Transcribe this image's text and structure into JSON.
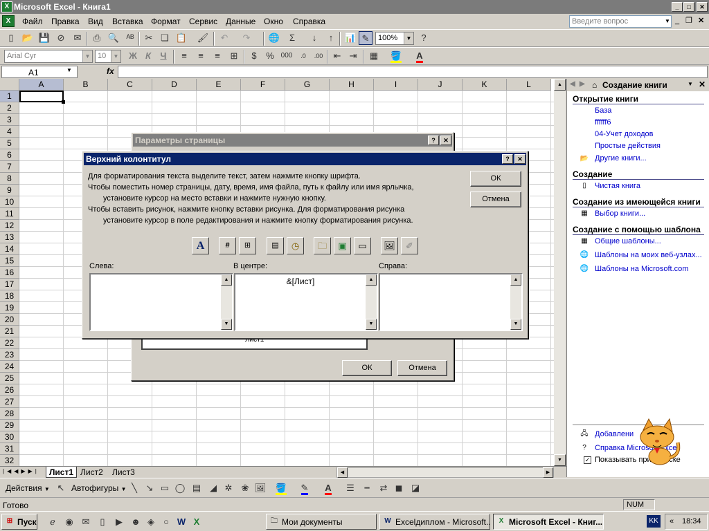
{
  "window": {
    "title": "Microsoft Excel - Книга1",
    "btn_min": "_",
    "btn_max": "□",
    "btn_close": "✕"
  },
  "menu": [
    "Файл",
    "Правка",
    "Вид",
    "Вставка",
    "Формат",
    "Сервис",
    "Данные",
    "Окно",
    "Справка"
  ],
  "help_placeholder": "Введите вопрос",
  "toolbar": {
    "zoom": "100%",
    "font": "Arial Cyr",
    "size": "10",
    "bold": "Ж",
    "italic": "К",
    "underline": "Ч",
    "percent": "%",
    "thousands": "000",
    "autosum": "Σ",
    "help": "?"
  },
  "formula_bar": {
    "cell": "A1",
    "fx": "fx",
    "value": ""
  },
  "columns": [
    "A",
    "B",
    "C",
    "D",
    "E",
    "F",
    "G",
    "H",
    "I",
    "J",
    "K",
    "L"
  ],
  "rows": [
    "1",
    "2",
    "3",
    "4",
    "5",
    "6",
    "7",
    "8",
    "9",
    "10",
    "11",
    "12",
    "13",
    "14",
    "15",
    "16",
    "17",
    "18",
    "19",
    "20",
    "21",
    "22",
    "23",
    "24",
    "25",
    "26",
    "27",
    "28",
    "29",
    "30",
    "31",
    "32"
  ],
  "sheets": [
    "Лист1",
    "Лист2",
    "Лист3"
  ],
  "taskpane": {
    "title": "Создание книги",
    "open_header": "Открытие книги",
    "open_links": [
      "База",
      "ffffff6",
      "04-Учет доходов",
      "Простые действия"
    ],
    "more_link": "Другие книги...",
    "create_header": "Создание",
    "blank_link": "Чистая книга",
    "from_existing_header": "Создание из имеющейся книги",
    "choose_link": "Выбор книги...",
    "template_header": "Создание с помощью шаблона",
    "template_links": [
      "Общие шаблоны...",
      "Шаблоны на моих веб-узлах...",
      "Шаблоны на Microsoft.com"
    ],
    "bottom_add": "Добавлени",
    "bottom_help": "Справка Microsoft Excel",
    "show_startup": "Показывать при запуске"
  },
  "page_setup": {
    "title": "Параметры страницы",
    "preview_text": "Лист1",
    "ok": "ОК",
    "cancel": "Отмена"
  },
  "header_dialog": {
    "title": "Верхний колонтитул",
    "instr1": "Для форматирования текста выделите текст, затем  нажмите кнопку шрифта.",
    "instr2": "Чтобы поместить номер страницы, дату, время, имя файла, путь к файлу или имя ярлычка,",
    "instr3": "установите курсор на место вставки и нажмите нужную кнопку.",
    "instr4": "Чтобы вставить рисунок, нажмите кнопку вставки рисунка.  Для форматирования рисунка",
    "instr5": "установите курсор в поле редактирования и нажмите кнопку форматирования рисунка.",
    "ok": "ОК",
    "cancel": "Отмена",
    "left_label": "Слева:",
    "center_label": "В центре:",
    "right_label": "Справа:",
    "center_value": "&[Лист]",
    "btn_font": "A"
  },
  "drawbar": {
    "actions": "Действия",
    "autoshapes": "Автофигуры"
  },
  "status": {
    "ready": "Готово",
    "num": "NUM"
  },
  "taskbar": {
    "start": "Пуск",
    "items": [
      "Мои документы",
      "Excelдиплом - Microsoft...",
      "Microsoft Excel - Книг..."
    ],
    "lang": "KK",
    "time": "18:34"
  },
  "colors": {
    "active_caption": "#0a246a",
    "inactive_caption": "#808080",
    "link": "#0000cc"
  }
}
